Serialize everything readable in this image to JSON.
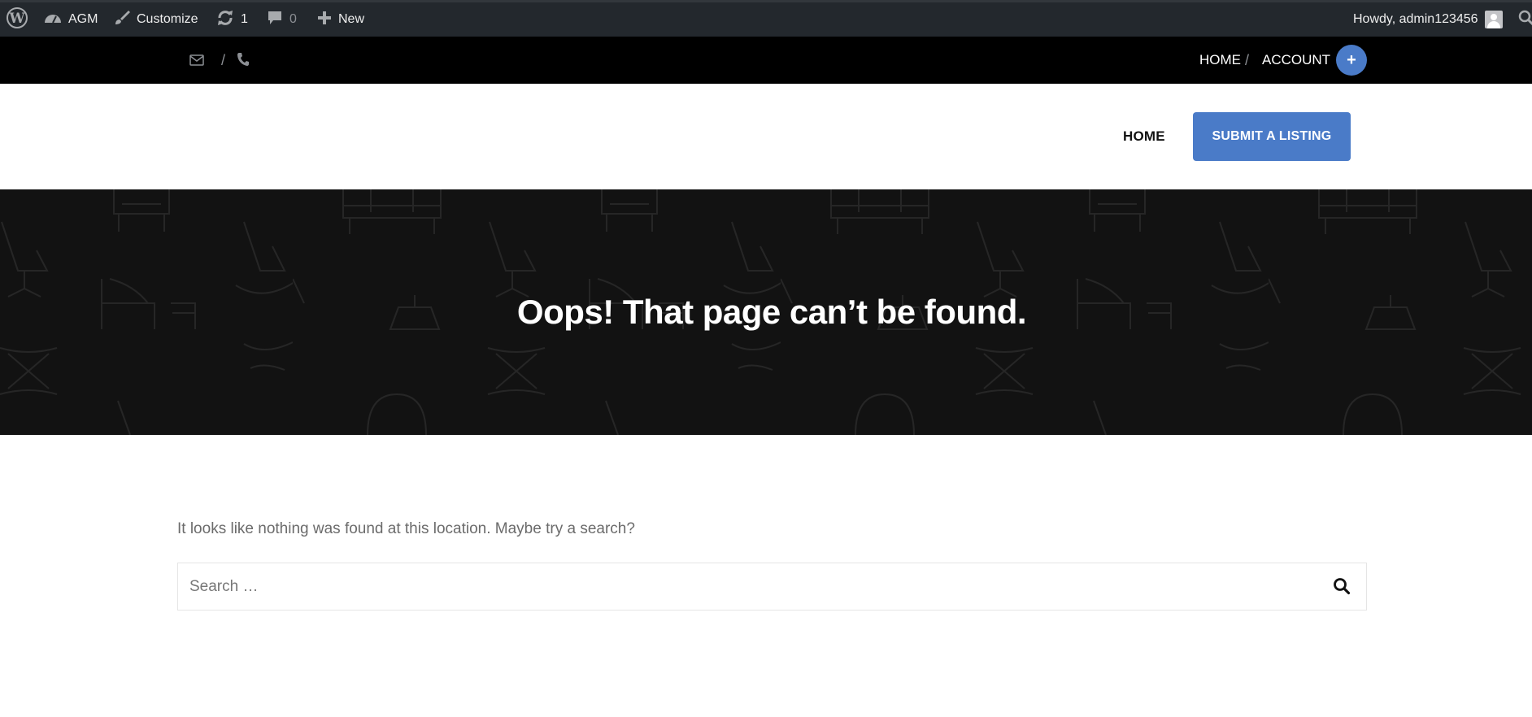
{
  "admin_bar": {
    "site_name": "AGM",
    "customize_label": "Customize",
    "updates_count": "1",
    "comments_count": "0",
    "new_label": "New",
    "greeting": "Howdy, admin123456"
  },
  "top_bar": {
    "separator": "/",
    "nav": [
      "HOME",
      "/",
      "ACCOUNT"
    ],
    "plus_symbol": "+"
  },
  "header": {
    "nav_home": "HOME",
    "submit_label": "SUBMIT A LISTING"
  },
  "hero": {
    "title": "Oops! That page can’t be found."
  },
  "content": {
    "message": "It looks like nothing was found at this location. Maybe try a search?",
    "search_placeholder": "Search …"
  },
  "colors": {
    "accent": "#4a7bc8",
    "admin_bar": "#23282d",
    "hero_bg": "#121212"
  },
  "icons": [
    "wordpress-icon",
    "dashboard-icon",
    "brush-icon",
    "updates-icon",
    "comment-icon",
    "plus-icon",
    "avatar",
    "search-icon",
    "envelope-icon",
    "phone-icon",
    "search-submit-icon"
  ]
}
